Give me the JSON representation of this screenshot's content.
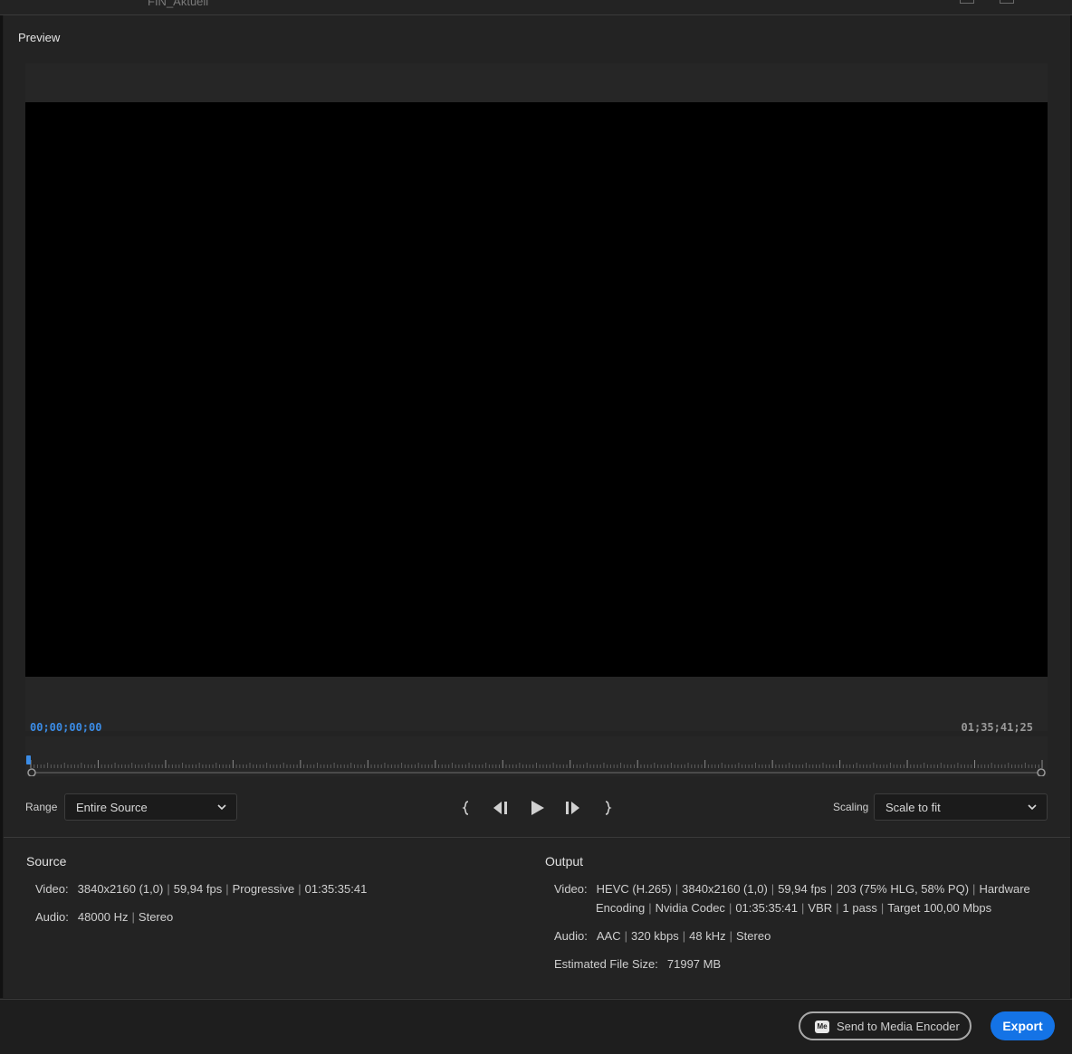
{
  "window": {
    "title": "FIN_Aktuell"
  },
  "preview": {
    "label": "Preview",
    "timecode_start": "00;00;00;00",
    "timecode_end": "01;35;41;25"
  },
  "controls": {
    "range_label": "Range",
    "range_value": "Entire Source",
    "scaling_label": "Scaling",
    "scaling_value": "Scale to fit",
    "transport_icons": [
      "mark-in-icon",
      "step-back-icon",
      "play-icon",
      "step-forward-icon",
      "mark-out-icon"
    ]
  },
  "source": {
    "title": "Source",
    "video_key": "Video:",
    "video_parts": [
      "3840x2160 (1,0)",
      "59,94 fps",
      "Progressive",
      "01:35:35:41"
    ],
    "audio_key": "Audio:",
    "audio_parts": [
      "48000 Hz",
      "Stereo"
    ]
  },
  "output": {
    "title": "Output",
    "video_key": "Video:",
    "video_line1": [
      "HEVC (H.265)",
      "3840x2160 (1,0)",
      "59,94 fps",
      "203 (75% HLG, 58% PQ)",
      "Hardware"
    ],
    "video_line2": [
      "Encoding",
      "Nvidia Codec",
      "01:35:35:41",
      "VBR",
      "1 pass",
      "Target 100,00 Mbps"
    ],
    "audio_key": "Audio:",
    "audio_parts": [
      "AAC",
      "320 kbps",
      "48 kHz",
      "Stereo"
    ],
    "filesize_key": "Estimated File Size:",
    "filesize_value": "71997 MB"
  },
  "footer": {
    "send_label": "Send to Media Encoder",
    "send_icon_text": "Me",
    "export_label": "Export"
  },
  "colors": {
    "accent": "#1473e6",
    "timecode_active": "#3b8ce6"
  }
}
